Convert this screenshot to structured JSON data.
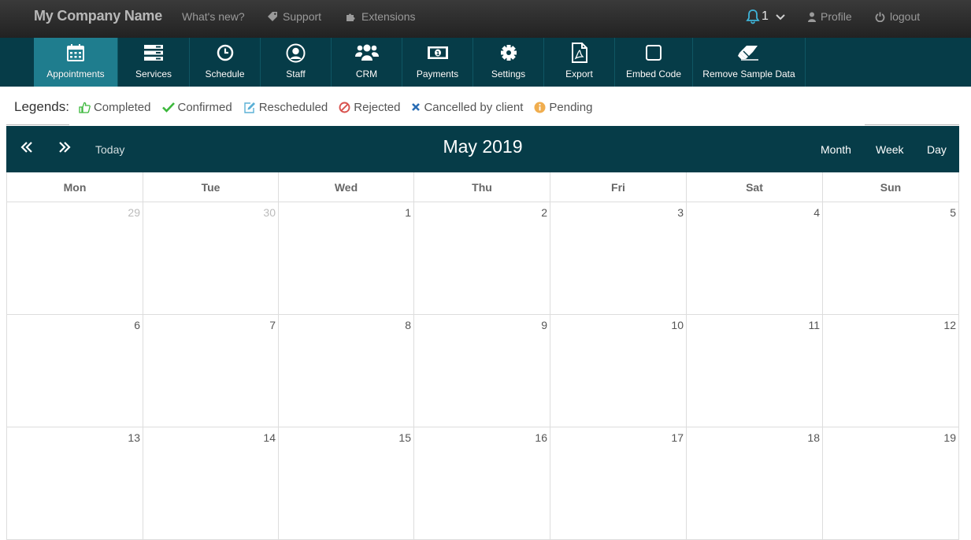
{
  "topbar": {
    "brand": "My Company Name",
    "whats_new": "What's new?",
    "support": "Support",
    "extensions": "Extensions",
    "notifications_count": "1",
    "profile": "Profile",
    "logout": "logout"
  },
  "nav": {
    "items": [
      {
        "label": "Appointments",
        "icon": "calendar-icon"
      },
      {
        "label": "Services",
        "icon": "server-icon"
      },
      {
        "label": "Schedule",
        "icon": "clock-icon"
      },
      {
        "label": "Staff",
        "icon": "user-icon"
      },
      {
        "label": "CRM",
        "icon": "users-icon"
      },
      {
        "label": "Payments",
        "icon": "money-icon"
      },
      {
        "label": "Settings",
        "icon": "gear-icon"
      },
      {
        "label": "Export",
        "icon": "pdf-file-icon"
      },
      {
        "label": "Embed Code",
        "icon": "square-icon"
      },
      {
        "label": "Remove Sample Data",
        "icon": "eraser-icon"
      }
    ],
    "active_index": 0
  },
  "legends": {
    "title": "Legends:",
    "items": [
      {
        "label": "Completed",
        "icon": "thumbs-up-icon",
        "color": "#3cb83c"
      },
      {
        "label": "Confirmed",
        "icon": "check-icon",
        "color": "#3cb83c"
      },
      {
        "label": "Rescheduled",
        "icon": "edit-icon",
        "color": "#5bb0d6"
      },
      {
        "label": "Rejected",
        "icon": "ban-icon",
        "color": "#d9534f"
      },
      {
        "label": "Cancelled by client",
        "icon": "x-icon",
        "color": "#2a6db5"
      },
      {
        "label": "Pending",
        "icon": "info-circle-icon",
        "color": "#f0ad4e"
      }
    ]
  },
  "calendar": {
    "title": "May 2019",
    "today_label": "Today",
    "views": [
      "Month",
      "Week",
      "Day"
    ],
    "weekdays": [
      "Mon",
      "Tue",
      "Wed",
      "Thu",
      "Fri",
      "Sat",
      "Sun"
    ],
    "weeks": [
      [
        {
          "d": "29",
          "other": true
        },
        {
          "d": "30",
          "other": true
        },
        {
          "d": "1"
        },
        {
          "d": "2"
        },
        {
          "d": "3"
        },
        {
          "d": "4"
        },
        {
          "d": "5"
        }
      ],
      [
        {
          "d": "6"
        },
        {
          "d": "7"
        },
        {
          "d": "8"
        },
        {
          "d": "9"
        },
        {
          "d": "10"
        },
        {
          "d": "11"
        },
        {
          "d": "12"
        }
      ],
      [
        {
          "d": "13"
        },
        {
          "d": "14"
        },
        {
          "d": "15"
        },
        {
          "d": "16"
        },
        {
          "d": "17"
        },
        {
          "d": "18"
        },
        {
          "d": "19"
        }
      ]
    ]
  },
  "colors": {
    "nav_bg": "#063c48",
    "nav_active": "#1f7d8e",
    "bell": "#3fb4d8"
  }
}
